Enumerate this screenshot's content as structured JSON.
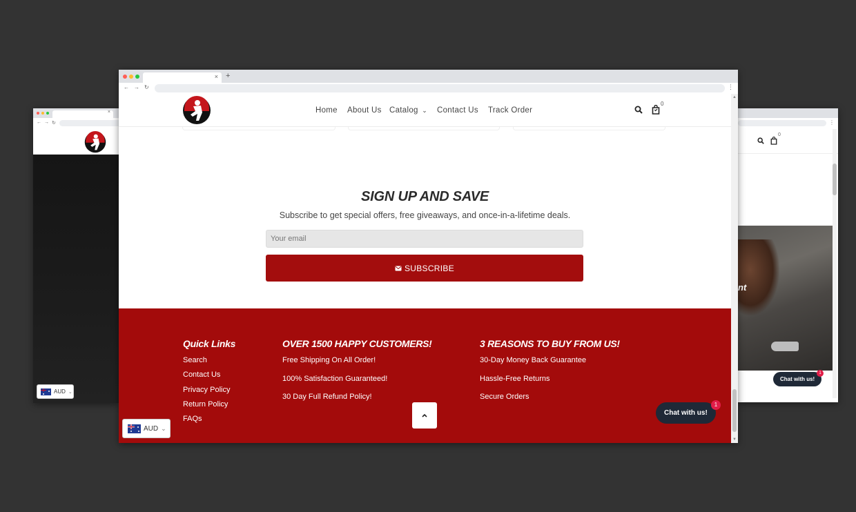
{
  "main": {
    "nav": {
      "home": "Home",
      "about": "About Us",
      "catalog": "Catalog",
      "contact": "Contact Us",
      "track": "Track Order"
    },
    "cart_count": "0",
    "signup": {
      "title": "SIGN UP AND SAVE",
      "subtitle": "Subscribe to get special offers, free giveaways, and once-in-a-lifetime deals.",
      "email_placeholder": "Your email",
      "subscribe_label": "SUBSCRIBE"
    },
    "footer": {
      "quick_links_heading": "Quick Links",
      "quick_links": [
        "Search",
        "Contact Us",
        "Privacy Policy",
        "Return Policy",
        "FAQs"
      ],
      "customers_heading": "OVER 1500 HAPPY CUSTOMERS!",
      "customers_points": [
        "Free Shipping On All Order!",
        "100% Satisfaction Guaranteed!",
        "30 Day Full Refund Policy!"
      ],
      "reasons_heading": "3 REASONS TO BUY FROM US!",
      "reasons_points": [
        "30-Day Money Back Guarantee",
        "Hassle-Free Returns",
        "Secure Orders"
      ]
    },
    "chat_label": "Chat with us!",
    "chat_badge": "1",
    "currency": "AUD"
  },
  "left": {
    "currency": "AUD"
  },
  "right": {
    "cart_count": "0",
    "hero_text": "nt",
    "chat_label": "Chat with us!",
    "chat_badge": "1"
  },
  "icons": {
    "back": "←",
    "forward": "→",
    "reload": "↻",
    "close": "×",
    "new_tab": "+",
    "menu": "⋮",
    "chevron": "⌄",
    "up": "⌃"
  },
  "colors": {
    "brand_red": "#a30d0d",
    "footer_red": "#a30b0b",
    "chat_dark": "#1f2937",
    "badge": "#e11d48",
    "backdrop": "#333333"
  }
}
